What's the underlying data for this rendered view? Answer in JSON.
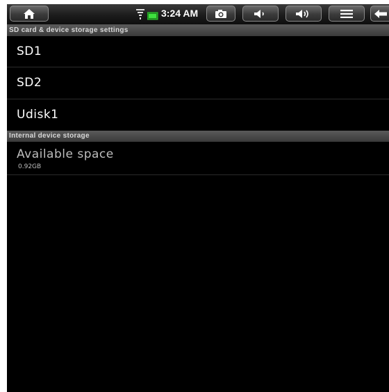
{
  "status_bar": {
    "time": "3:24 AM",
    "buttons": [
      "home-icon",
      "camera-icon",
      "volume-down-icon",
      "volume-up-icon",
      "menu-icon",
      "back-icon"
    ],
    "indicators": [
      "wifi-icon",
      "battery-icon"
    ]
  },
  "sections": {
    "sd_card": {
      "header": "SD card & device storage settings",
      "items": [
        {
          "label": "SD1"
        },
        {
          "label": "SD2"
        },
        {
          "label": "Udisk1"
        }
      ]
    },
    "internal": {
      "header": "Internal device storage",
      "available_label": "Available space",
      "available_value": "0.92GB"
    }
  }
}
